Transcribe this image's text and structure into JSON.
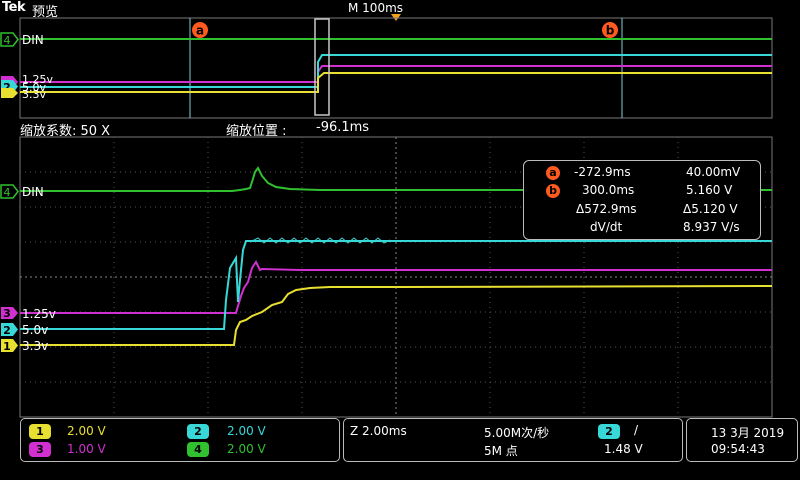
{
  "header": {
    "brand": "Tek",
    "mode": "预览",
    "timebase": "M 100ms"
  },
  "overview": {
    "cursor_a": "a",
    "cursor_b": "b",
    "ch4_label": "DIN",
    "ch2_label": "5.0v",
    "ch3_label": "1.25v",
    "ch1_label": "3.3v"
  },
  "zoom": {
    "factor_label": "缩放系数: 50 X",
    "position_label": "缩放位置 :",
    "position_value": "-96.1ms"
  },
  "zoom_channels": {
    "ch4": "DIN",
    "ch3": "1.25v",
    "ch2": "5.0v",
    "ch1": "3.3v"
  },
  "cursor_readout": {
    "a_time": "-272.9ms",
    "a_value": "40.00mV",
    "b_time": "300.0ms",
    "b_value": "5.160 V",
    "delta_time": "Δ572.9ms",
    "delta_value": "Δ5.120 V",
    "rate_label": "dV/dt",
    "rate_value": "8.937 V/s"
  },
  "channel_status": {
    "ch1_num": "1",
    "ch1_scale": "2.00 V",
    "ch2_num": "2",
    "ch2_scale": "2.00 V",
    "ch3_num": "3",
    "ch3_scale": "1.00 V",
    "ch4_num": "4",
    "ch4_scale": "2.00 V"
  },
  "acquisition": {
    "zoom_scale": "Z 2.00ms",
    "sample_rate": "5.00M次/秒",
    "record_length": "5M 点",
    "trigger_source": "2",
    "trigger_slope": "/",
    "trigger_level": "1.48 V"
  },
  "clock": {
    "date": "13 3月 2019",
    "time": "09:54:43"
  },
  "colors": {
    "ch1": "#e8e030",
    "ch2": "#38d8d8",
    "ch3": "#d030d0",
    "ch4": "#30c030",
    "cursor": "#ff5a1f"
  }
}
